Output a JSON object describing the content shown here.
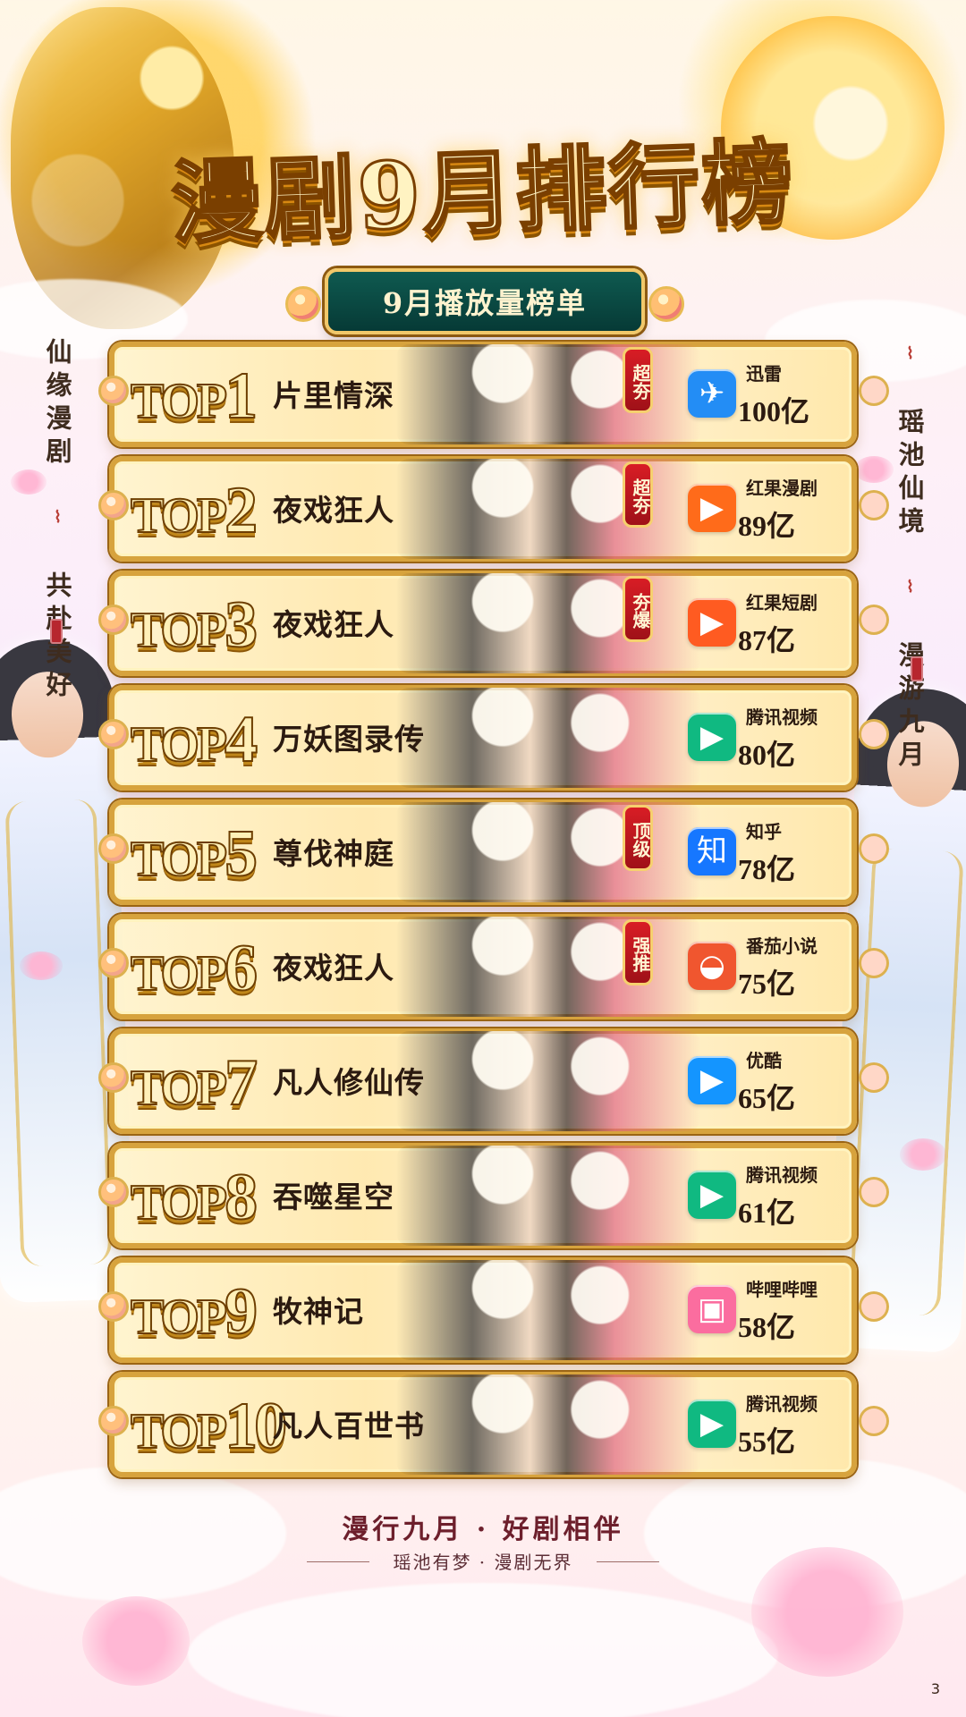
{
  "header": {
    "title": "漫剧9月排行榜",
    "subtitle": "9月播放量榜单"
  },
  "side_texts": {
    "left_first": "仙缘漫剧",
    "left_second": "共赴美好",
    "right_first": "瑶池仙境",
    "right_second": "漫游九月"
  },
  "ranking": [
    {
      "rank_prefix": "TOP",
      "rank_number": "1",
      "show_title": "片里情深",
      "badge": "超夯",
      "platform": "迅雷",
      "plays": "100亿",
      "icon_text": "✈",
      "icon_name": "xunlei-bird-icon",
      "icon_color": "#238df5"
    },
    {
      "rank_prefix": "TOP",
      "rank_number": "2",
      "show_title": "夜戏狂人",
      "badge": "超夯",
      "platform": "红果漫剧",
      "plays": "89亿",
      "icon_text": "▶",
      "icon_name": "hongguo-play-icon",
      "icon_color": "#ff6b1a"
    },
    {
      "rank_prefix": "TOP",
      "rank_number": "3",
      "show_title": "夜戏狂人",
      "badge": "夯爆",
      "platform": "红果短剧",
      "plays": "87亿",
      "icon_text": "▶",
      "icon_name": "hongguo-play-icon",
      "icon_color": "#ff5b21"
    },
    {
      "rank_prefix": "TOP",
      "rank_number": "4",
      "show_title": "万妖图录传",
      "badge": "",
      "platform": "腾讯视频",
      "plays": "80亿",
      "icon_text": "▶",
      "icon_name": "tencent-video-play-icon",
      "icon_color": "#10b981"
    },
    {
      "rank_prefix": "TOP",
      "rank_number": "5",
      "show_title": "尊伐神庭",
      "badge": "顶级",
      "platform": "知乎",
      "plays": "78亿",
      "icon_text": "知",
      "icon_name": "zhihu-icon",
      "icon_color": "#1677ff"
    },
    {
      "rank_prefix": "TOP",
      "rank_number": "6",
      "show_title": "夜戏狂人",
      "badge": "强推",
      "platform": "番茄小说",
      "plays": "75亿",
      "icon_text": "◒",
      "icon_name": "fanqie-icon",
      "icon_color": "#f0562f"
    },
    {
      "rank_prefix": "TOP",
      "rank_number": "7",
      "show_title": "凡人修仙传",
      "badge": "",
      "platform": "优酷",
      "plays": "65亿",
      "icon_text": "▶",
      "icon_name": "youku-play-icon",
      "icon_color": "#1495ff"
    },
    {
      "rank_prefix": "TOP",
      "rank_number": "8",
      "show_title": "吞噬星空",
      "badge": "",
      "platform": "腾讯视频",
      "plays": "61亿",
      "icon_text": "▶",
      "icon_name": "tencent-video-play-icon",
      "icon_color": "#10b981"
    },
    {
      "rank_prefix": "TOP",
      "rank_number": "9",
      "show_title": "牧神记",
      "badge": "",
      "platform": "哔哩哔哩",
      "plays": "58亿",
      "icon_text": "▣",
      "icon_name": "bilibili-tv-icon",
      "icon_color": "#fb6d9f"
    },
    {
      "rank_prefix": "TOP",
      "rank_number": "10",
      "show_title": "凡人百世书",
      "badge": "",
      "platform": "腾讯视频",
      "plays": "55亿",
      "icon_text": "▶",
      "icon_name": "tencent-video-play-icon",
      "icon_color": "#10b981"
    }
  ],
  "footer": {
    "title": "漫行九月 · 好剧相伴",
    "subtitle": "瑶池有梦 · 漫剧无界",
    "page_number": "3"
  }
}
